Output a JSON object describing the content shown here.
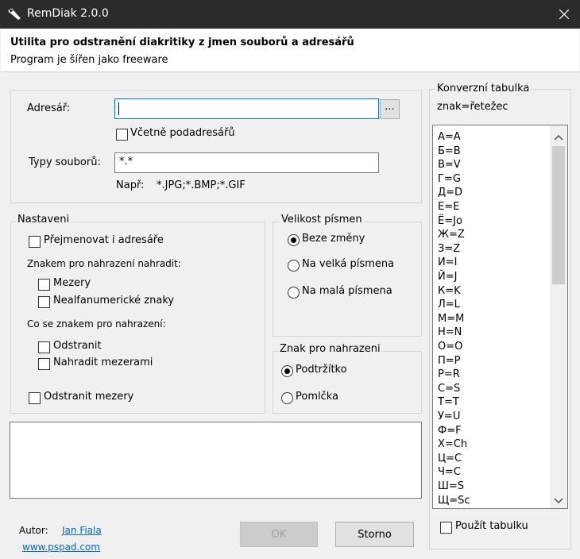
{
  "window": {
    "title": "RemDiak  2.0.0"
  },
  "header": {
    "title": "Utilita pro odstranění diakritiky z jmen souborů a adresářů",
    "subtitle": "Program je šířen jako freeware"
  },
  "path_panel": {
    "directory_label": "Adresář:",
    "directory_value": "",
    "browse_label": "...",
    "include_subdirs_label": "Včetně podadresářů",
    "file_types_label": "Typy souborů:",
    "file_types_value": "*.*",
    "example_prefix": "Např:",
    "example_value": "*.JPG;*.BMP;*.GIF"
  },
  "settings": {
    "group_label": "Nastaveni",
    "rename_dirs_label": "Přejmenovat i adresáře",
    "replace_with_char_label": "Znakem pro nahrazení nahradit:",
    "spaces_label": "Mezery",
    "nonalnum_label": "Nealfanumerické znaky",
    "what_to_do_label": "Co se znakem pro nahrazení:",
    "remove_label": "Odstranit",
    "replace_spaces_label": "Nahradit mezerami",
    "remove_spaces_label": "Odstranit mezery"
  },
  "letter_case": {
    "group_label": "Velikost písmen",
    "options": [
      "Beze změny",
      "Na velká písmena",
      "Na malá písmena"
    ],
    "selected": "Beze změny"
  },
  "replace_char": {
    "group_label": "Znak pro nahrazeni",
    "options": [
      "Podtržítko",
      "Pomlčka"
    ],
    "selected": "Podtržítko"
  },
  "conversion": {
    "group_label": "Konverzní tabulka",
    "format_label": "znak=řetežec",
    "items": [
      "А=A",
      "Б=B",
      "В=V",
      "Г=G",
      "Д=D",
      "Е=E",
      "Ё=Jo",
      "Ж=Z",
      "З=Z",
      "И=I",
      "Й=J",
      "К=K",
      "Л=L",
      "М=M",
      "Н=N",
      "О=O",
      "П=P",
      "Р=R",
      "С=S",
      "Т=T",
      "У=U",
      "Ф=F",
      "Х=Ch",
      "Ц=C",
      "Ч=C",
      "Ш=S",
      "Щ=Sc"
    ],
    "use_table_label": "Použít tabulku"
  },
  "footer": {
    "author_label": "Autor:",
    "author_name": "Jan Fiala",
    "website": "www.pspad.com",
    "ok_label": "OK",
    "cancel_label": "Storno"
  },
  "colors": {
    "titlebar": "#2b2b2b",
    "focus": "#0078d7",
    "link": "#0066cc"
  }
}
